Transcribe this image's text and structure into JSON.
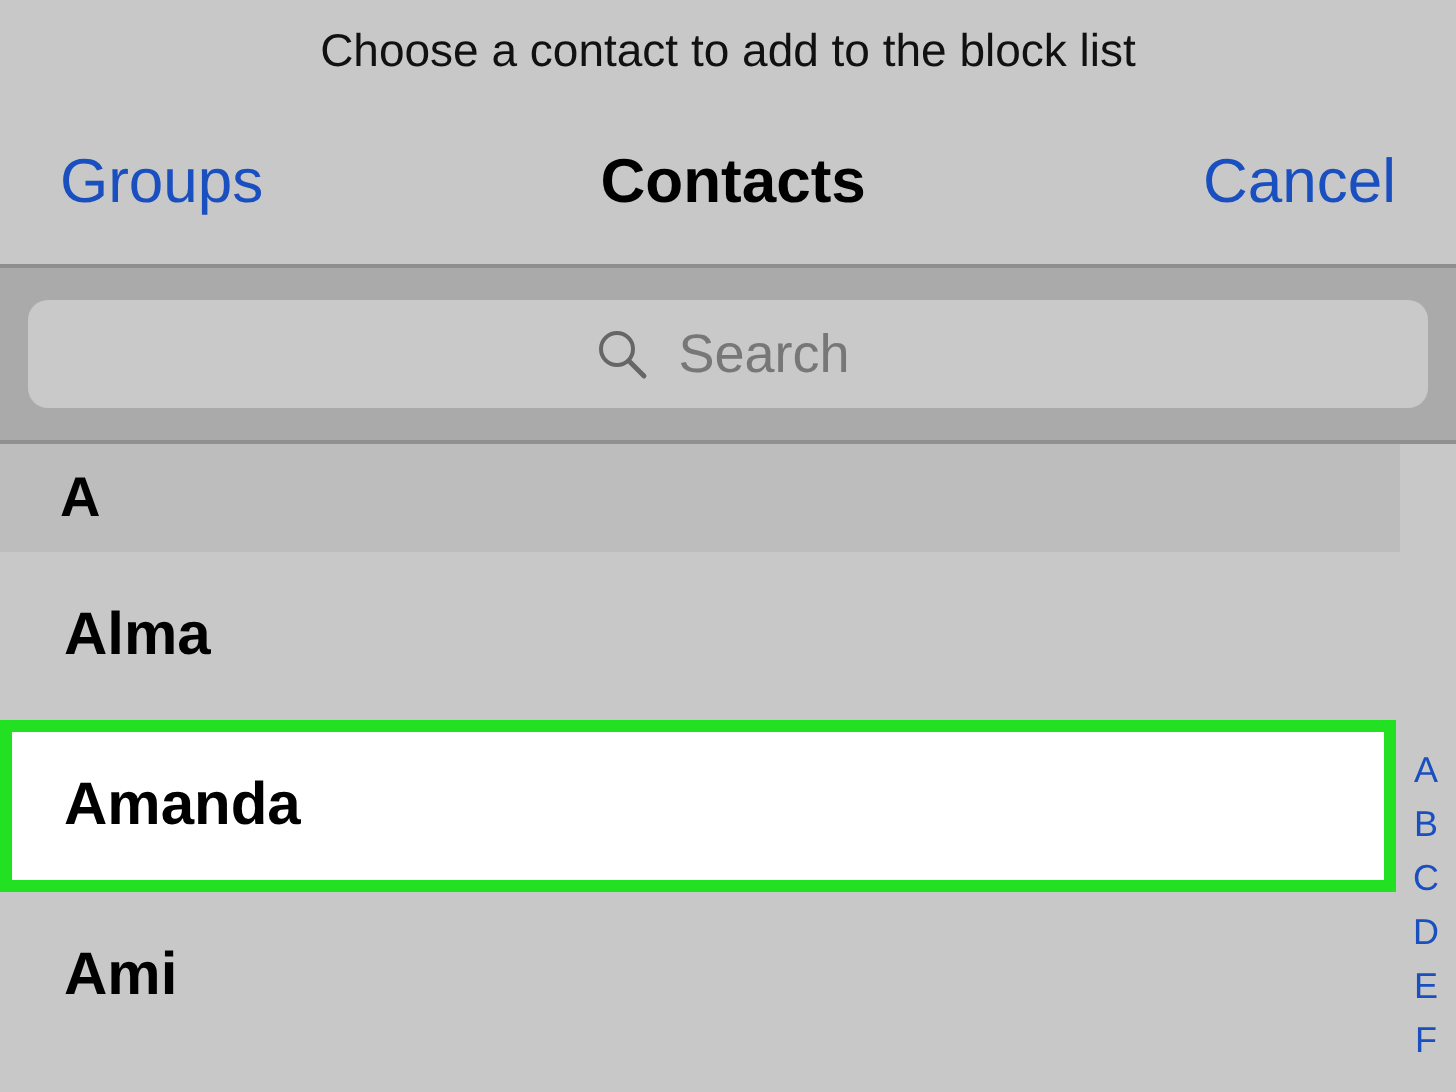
{
  "prompt": "Choose a contact to add to the block list",
  "nav": {
    "left": "Groups",
    "title": "Contacts",
    "right": "Cancel"
  },
  "search": {
    "placeholder": "Search"
  },
  "section": "A",
  "contacts": [
    {
      "name": "Alma",
      "selected": false
    },
    {
      "name": "Amanda",
      "selected": true
    },
    {
      "name": "Ami",
      "selected": false
    }
  ],
  "index": [
    "A",
    "B",
    "C",
    "D",
    "E",
    "F"
  ]
}
